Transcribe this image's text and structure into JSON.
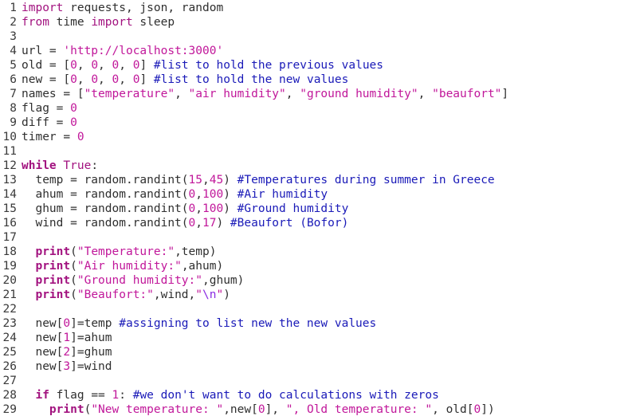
{
  "editor": {
    "lines": [
      {
        "n": "1",
        "tokens": [
          [
            "kw",
            "import"
          ],
          [
            "pl",
            " requests, json, random"
          ]
        ]
      },
      {
        "n": "2",
        "tokens": [
          [
            "kw",
            "from"
          ],
          [
            "pl",
            " time "
          ],
          [
            "kw",
            "import"
          ],
          [
            "pl",
            " sleep"
          ]
        ]
      },
      {
        "n": "3",
        "tokens": []
      },
      {
        "n": "4",
        "tokens": [
          [
            "pl",
            "url = "
          ],
          [
            "str",
            "'http://localhost:3000'"
          ]
        ]
      },
      {
        "n": "5",
        "tokens": [
          [
            "pl",
            "old = ["
          ],
          [
            "num",
            "0"
          ],
          [
            "pl",
            ", "
          ],
          [
            "num",
            "0"
          ],
          [
            "pl",
            ", "
          ],
          [
            "num",
            "0"
          ],
          [
            "pl",
            ", "
          ],
          [
            "num",
            "0"
          ],
          [
            "pl",
            "] "
          ],
          [
            "com",
            "#list to hold the previous values"
          ]
        ]
      },
      {
        "n": "6",
        "tokens": [
          [
            "pl",
            "new = ["
          ],
          [
            "num",
            "0"
          ],
          [
            "pl",
            ", "
          ],
          [
            "num",
            "0"
          ],
          [
            "pl",
            ", "
          ],
          [
            "num",
            "0"
          ],
          [
            "pl",
            ", "
          ],
          [
            "num",
            "0"
          ],
          [
            "pl",
            "] "
          ],
          [
            "com",
            "#list to hold the new values"
          ]
        ]
      },
      {
        "n": "7",
        "tokens": [
          [
            "pl",
            "names = ["
          ],
          [
            "str",
            "\"temperature\""
          ],
          [
            "pl",
            ", "
          ],
          [
            "str",
            "\"air humidity\""
          ],
          [
            "pl",
            ", "
          ],
          [
            "str",
            "\"ground humidity\""
          ],
          [
            "pl",
            ", "
          ],
          [
            "str",
            "\"beaufort\""
          ],
          [
            "pl",
            "]"
          ]
        ]
      },
      {
        "n": "8",
        "tokens": [
          [
            "pl",
            "flag = "
          ],
          [
            "num",
            "0"
          ]
        ]
      },
      {
        "n": "9",
        "tokens": [
          [
            "pl",
            "diff = "
          ],
          [
            "num",
            "0"
          ]
        ]
      },
      {
        "n": "10",
        "tokens": [
          [
            "pl",
            "timer = "
          ],
          [
            "num",
            "0"
          ]
        ]
      },
      {
        "n": "11",
        "tokens": []
      },
      {
        "n": "12",
        "tokens": [
          [
            "kwb",
            "while"
          ],
          [
            "pl",
            " "
          ],
          [
            "kw",
            "True"
          ],
          [
            "pl",
            ":"
          ]
        ]
      },
      {
        "n": "13",
        "tokens": [
          [
            "pl",
            "  temp = random.randint("
          ],
          [
            "num",
            "15"
          ],
          [
            "pl",
            ","
          ],
          [
            "num",
            "45"
          ],
          [
            "pl",
            ") "
          ],
          [
            "com",
            "#Temperatures during summer in Greece"
          ]
        ]
      },
      {
        "n": "14",
        "tokens": [
          [
            "pl",
            "  ahum = random.randint("
          ],
          [
            "num",
            "0"
          ],
          [
            "pl",
            ","
          ],
          [
            "num",
            "100"
          ],
          [
            "pl",
            ") "
          ],
          [
            "com",
            "#Air humidity"
          ]
        ]
      },
      {
        "n": "15",
        "tokens": [
          [
            "pl",
            "  ghum = random.randint("
          ],
          [
            "num",
            "0"
          ],
          [
            "pl",
            ","
          ],
          [
            "num",
            "100"
          ],
          [
            "pl",
            ") "
          ],
          [
            "com",
            "#Ground humidity"
          ]
        ]
      },
      {
        "n": "16",
        "tokens": [
          [
            "pl",
            "  wind = random.randint("
          ],
          [
            "num",
            "0"
          ],
          [
            "pl",
            ","
          ],
          [
            "num",
            "17"
          ],
          [
            "pl",
            ") "
          ],
          [
            "com",
            "#Beaufort (Bofor)"
          ]
        ]
      },
      {
        "n": "17",
        "tokens": []
      },
      {
        "n": "18",
        "tokens": [
          [
            "pl",
            "  "
          ],
          [
            "kwb",
            "print"
          ],
          [
            "pl",
            "("
          ],
          [
            "str",
            "\"Temperature:\""
          ],
          [
            "pl",
            ",temp)"
          ]
        ]
      },
      {
        "n": "19",
        "tokens": [
          [
            "pl",
            "  "
          ],
          [
            "kwb",
            "print"
          ],
          [
            "pl",
            "("
          ],
          [
            "str",
            "\"Air humidity:\""
          ],
          [
            "pl",
            ",ahum)"
          ]
        ]
      },
      {
        "n": "20",
        "tokens": [
          [
            "pl",
            "  "
          ],
          [
            "kwb",
            "print"
          ],
          [
            "pl",
            "("
          ],
          [
            "str",
            "\"Ground humidity:\""
          ],
          [
            "pl",
            ",ghum)"
          ]
        ]
      },
      {
        "n": "21",
        "tokens": [
          [
            "pl",
            "  "
          ],
          [
            "kwb",
            "print"
          ],
          [
            "pl",
            "("
          ],
          [
            "str",
            "\"Beaufort:\""
          ],
          [
            "pl",
            ",wind,"
          ],
          [
            "str",
            "\""
          ],
          [
            "esc",
            "\\n"
          ],
          [
            "str",
            "\""
          ],
          [
            "pl",
            ")"
          ]
        ]
      },
      {
        "n": "22",
        "tokens": []
      },
      {
        "n": "23",
        "tokens": [
          [
            "pl",
            "  new["
          ],
          [
            "num",
            "0"
          ],
          [
            "pl",
            "]=temp "
          ],
          [
            "com",
            "#assigning to list new the new values"
          ]
        ]
      },
      {
        "n": "24",
        "tokens": [
          [
            "pl",
            "  new["
          ],
          [
            "num",
            "1"
          ],
          [
            "pl",
            "]=ahum"
          ]
        ]
      },
      {
        "n": "25",
        "tokens": [
          [
            "pl",
            "  new["
          ],
          [
            "num",
            "2"
          ],
          [
            "pl",
            "]=ghum"
          ]
        ]
      },
      {
        "n": "26",
        "tokens": [
          [
            "pl",
            "  new["
          ],
          [
            "num",
            "3"
          ],
          [
            "pl",
            "]=wind"
          ]
        ]
      },
      {
        "n": "27",
        "tokens": []
      },
      {
        "n": "28",
        "tokens": [
          [
            "pl",
            "  "
          ],
          [
            "kwb",
            "if"
          ],
          [
            "pl",
            " flag == "
          ],
          [
            "num",
            "1"
          ],
          [
            "pl",
            ": "
          ],
          [
            "com",
            "#we don't want to do calculations with zeros"
          ]
        ]
      },
      {
        "n": "29",
        "tokens": [
          [
            "pl",
            "    "
          ],
          [
            "kwb",
            "print"
          ],
          [
            "pl",
            "("
          ],
          [
            "str",
            "\"New temperature: \""
          ],
          [
            "pl",
            ",new["
          ],
          [
            "num",
            "0"
          ],
          [
            "pl",
            "], "
          ],
          [
            "str",
            "\", Old temperature: \""
          ],
          [
            "pl",
            ", old["
          ],
          [
            "num",
            "0"
          ],
          [
            "pl",
            "])"
          ]
        ]
      }
    ]
  },
  "colors": {
    "keyword": "#a2127f",
    "string": "#c1179a",
    "comment": "#1a1ab8",
    "text": "#2f2f2f",
    "background": "#ffffff"
  }
}
